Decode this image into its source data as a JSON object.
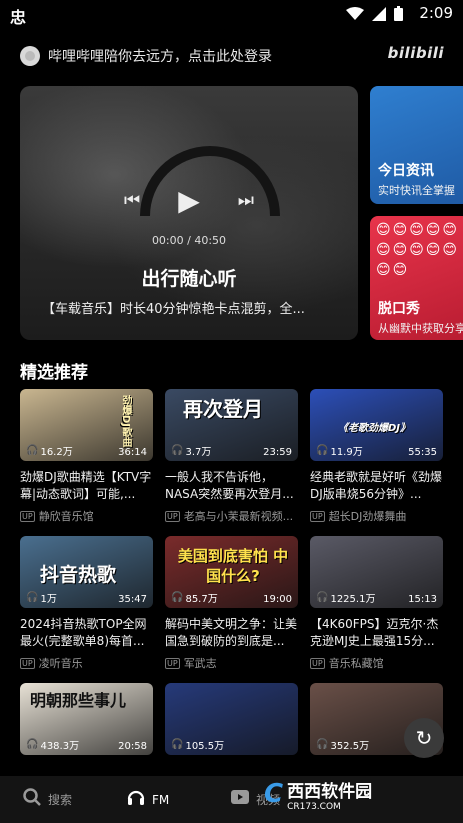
{
  "status_bar": {
    "app_glyph": "忠",
    "time": "2:09"
  },
  "login": {
    "text": "哔哩哔哩陪你去远方，点击此处登录",
    "brand": "bilibili"
  },
  "hero": {
    "time_progress": "00:00 / 40:50",
    "title": "出行随心听",
    "subtitle": "【车载音乐】时长40分钟惊艳卡点混剪，全..."
  },
  "side_cards": [
    {
      "title": "今日资讯",
      "subtitle": "实时快讯全掌握",
      "color": "#2f7fd0"
    },
    {
      "title": "脱口秀",
      "subtitle": "从幽默中获取分享",
      "color": "#e8344b",
      "emoji": "😊😊😊😊😊😊😊😊😊😊😊😊"
    }
  ],
  "section_title": "精选推荐",
  "videos": [
    {
      "overlay": "劲爆DJ歌曲",
      "plays": "16.2万",
      "duration": "36:14",
      "title": "劲爆DJ歌曲精选【KTV字幕|动态歌词】可能,...",
      "uploader": "静欣音乐馆",
      "bg": "#c9b690"
    },
    {
      "overlay": "再次登月",
      "plays": "3.7万",
      "duration": "23:59",
      "title": "一般人我不告诉他，NASA突然要再次登月...",
      "uploader": "老高与小茉最新视频...",
      "bg": "#3a4a63"
    },
    {
      "overlay": "《老歌劲爆DJ》",
      "plays": "11.9万",
      "duration": "55:35",
      "title": "经典老歌就是好听《劲爆DJ版串烧56分钟》...",
      "uploader": "超长DJ劲爆舞曲",
      "bg": "#2c4fb8"
    },
    {
      "overlay": "抖音热歌",
      "plays": "1万",
      "duration": "35:47",
      "title": "2024抖音热歌TOP全网最火(完整歌单8)每首...",
      "uploader": "凌听音乐",
      "bg": "#4a6f8f"
    },
    {
      "overlay": "美国到底害怕 中国什么?",
      "plays": "85.7万",
      "duration": "19:00",
      "title": "解码中美文明之争：让美国急到破防的到底是...",
      "uploader": "军武志",
      "bg": "#7a2b2b"
    },
    {
      "overlay": "",
      "plays": "1225.1万",
      "duration": "15:13",
      "title": "【4K60FPS】迈克尔·杰克逊MJ史上最强15分...",
      "uploader": "音乐私藏馆",
      "bg": "#5a5a66"
    },
    {
      "overlay": "明朝那些事儿",
      "plays": "438.3万",
      "duration": "20:58",
      "title": "",
      "uploader": "",
      "bg": "#e8e2d6"
    },
    {
      "overlay": "",
      "plays": "105.5万",
      "duration": "",
      "title": "",
      "uploader": "",
      "bg": "#263a7a"
    },
    {
      "overlay": "",
      "plays": "352.5万",
      "duration": "",
      "title": "",
      "uploader": "",
      "bg": "#6a5048"
    }
  ],
  "nav": [
    {
      "icon": "search-icon",
      "label": "搜索"
    },
    {
      "icon": "headphones-icon",
      "label": "FM"
    },
    {
      "icon": "video-icon",
      "label": "视频"
    }
  ],
  "watermark": {
    "logo": "C",
    "text": "西西软件园",
    "url": "CR173.COM"
  }
}
